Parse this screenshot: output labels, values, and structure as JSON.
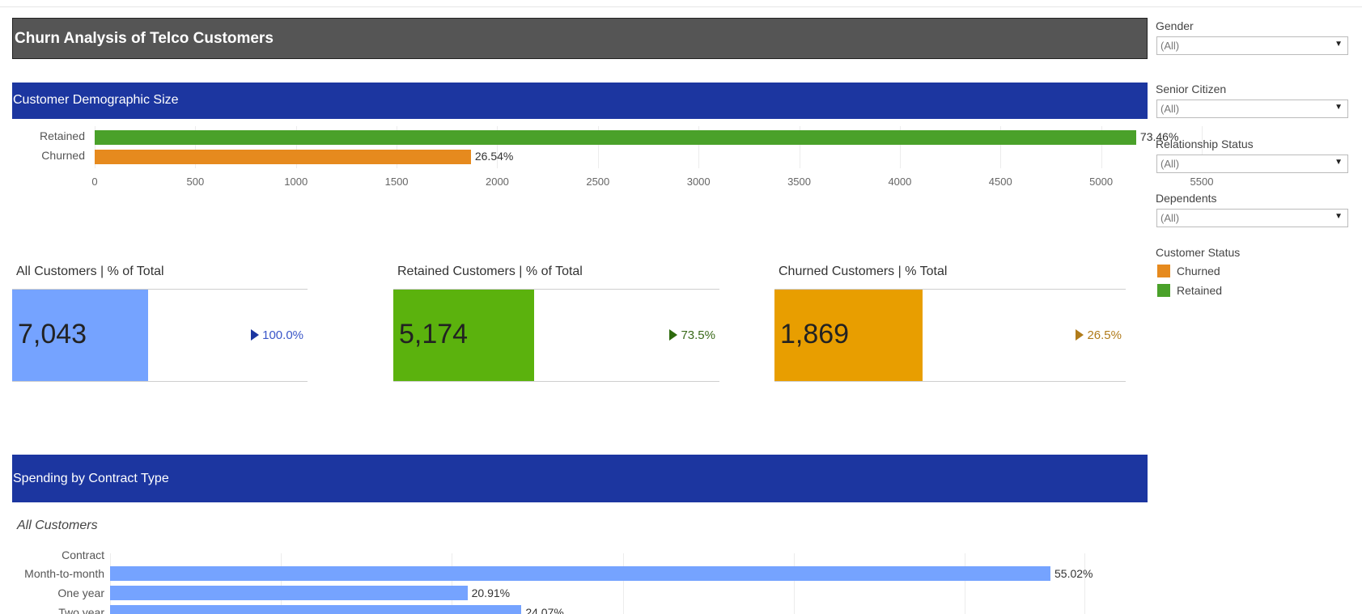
{
  "title": "Churn Analysis of Telco Customers",
  "sections": {
    "demographic": "Customer Demographic Size",
    "spending": "Spending by Contract Type"
  },
  "colors": {
    "header_bg": "#555555",
    "section_bg": "#1c36a0",
    "retained": "#4aa12a",
    "churned": "#e68a1e",
    "all_kpi": "#75a3ff",
    "retained_kpi": "#5bb20d",
    "churned_kpi": "#e89e00",
    "contract_bar": "#75a3ff"
  },
  "chart_data": [
    {
      "type": "bar",
      "orientation": "horizontal",
      "categories": [
        "Retained",
        "Churned"
      ],
      "values": [
        5174,
        1869
      ],
      "data_labels": [
        "73.46%",
        "26.54%"
      ],
      "colors": [
        "#4aa12a",
        "#e68a1e"
      ],
      "xlim": [
        0,
        5700
      ],
      "xticks": [
        "0",
        "500",
        "1000",
        "1500",
        "2000",
        "2500",
        "3000",
        "3500",
        "4000",
        "4500",
        "5000",
        "5500"
      ],
      "grid": true
    },
    {
      "type": "bar",
      "orientation": "horizontal",
      "subtitle": "All Customers",
      "ylabel": "Contract",
      "categories": [
        "Month-to-month",
        "One year",
        "Two year"
      ],
      "values": [
        55.02,
        20.91,
        24.07
      ],
      "data_labels": [
        "55.02%",
        "20.91%",
        "24.07%"
      ],
      "xlim": [
        0,
        57
      ],
      "grid": true
    }
  ],
  "kpis": [
    {
      "title": "All Customers | % of Total",
      "value": "7,043",
      "pct": "100.0%",
      "share": 1.0,
      "color": "#75a3ff",
      "pct_color": "#3a56c8",
      "tri_color": "#1c36a0"
    },
    {
      "title": "Retained Customers | % of Total",
      "value": "5,174",
      "pct": "73.5%",
      "share": 0.735,
      "color": "#5bb20d",
      "pct_color": "#3a6a1a",
      "tri_color": "#2d6a0d"
    },
    {
      "title": "Churned Customers | % Total",
      "value": "1,869",
      "pct": "26.5%",
      "share": 0.265,
      "color": "#e89e00",
      "pct_color": "#b07b1a",
      "tri_color": "#b07b1a"
    }
  ],
  "filters": [
    {
      "label": "Gender",
      "value": "(All)"
    },
    {
      "label": "Senior Citizen",
      "value": "(All)"
    },
    {
      "label": "Relationship Status",
      "value": "(All)"
    },
    {
      "label": "Dependents",
      "value": "(All)"
    }
  ],
  "legend": {
    "title": "Customer Status",
    "items": [
      {
        "label": "Churned",
        "color": "#e68a1e"
      },
      {
        "label": "Retained",
        "color": "#4aa12a"
      }
    ]
  }
}
